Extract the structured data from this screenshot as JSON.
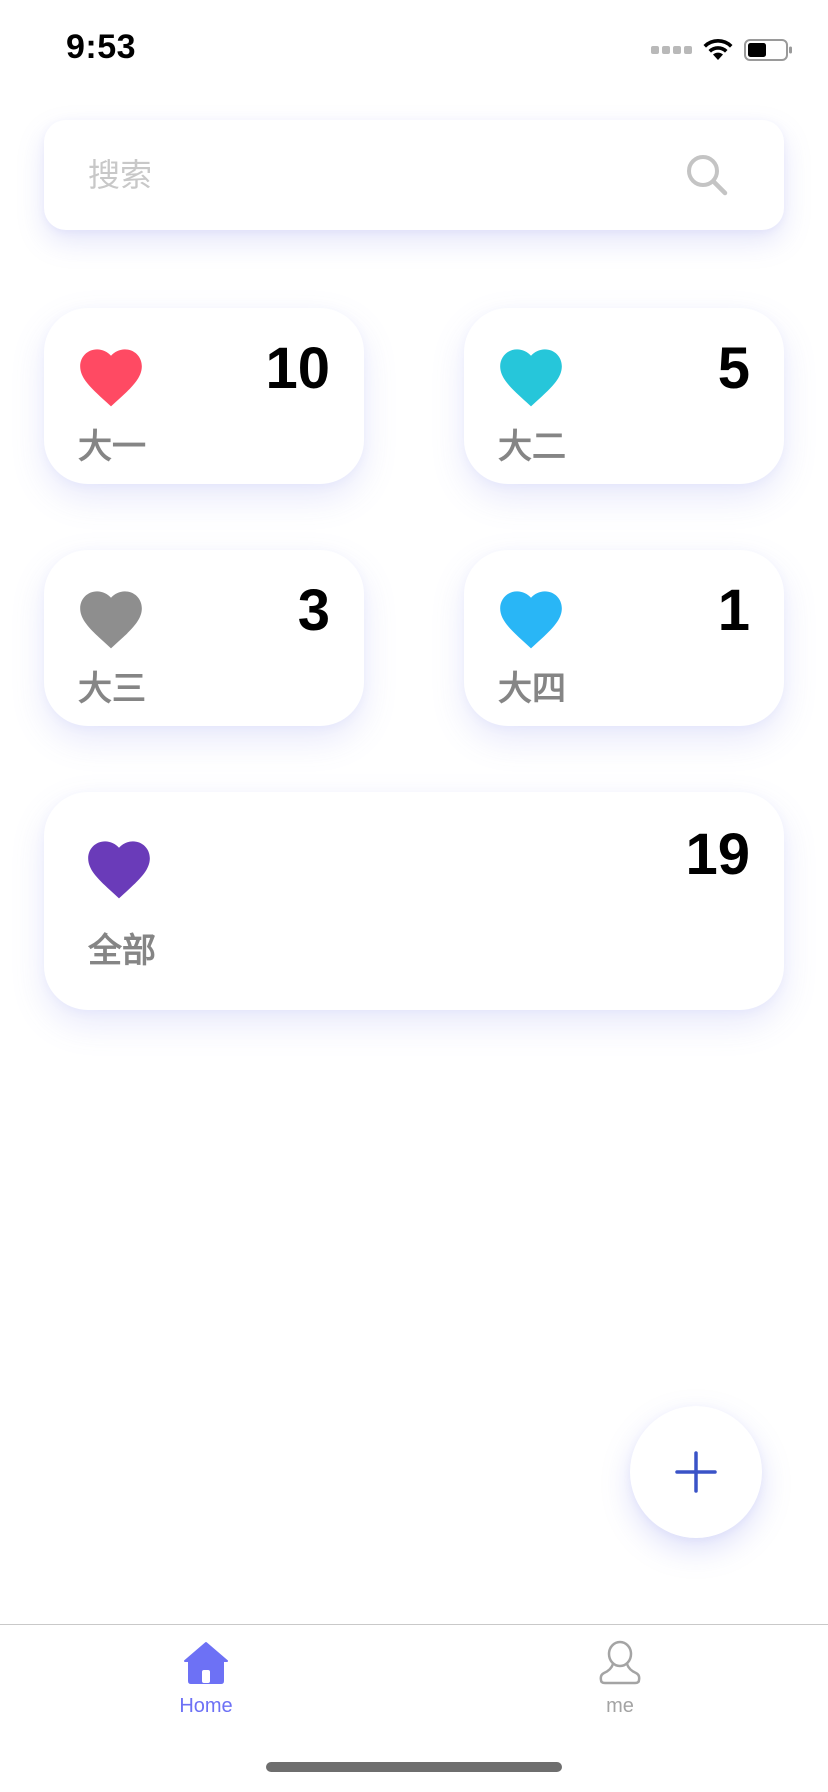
{
  "status_bar": {
    "time": "9:53"
  },
  "search": {
    "placeholder": "搜索",
    "value": ""
  },
  "categories": [
    {
      "label": "大一",
      "count": "10",
      "heart_color": "#ff4a63"
    },
    {
      "label": "大二",
      "count": "5",
      "heart_color": "#26c6da"
    },
    {
      "label": "大三",
      "count": "3",
      "heart_color": "#8e8e8e"
    },
    {
      "label": "大四",
      "count": "1",
      "heart_color": "#29b6f6"
    }
  ],
  "total": {
    "label": "全部",
    "count": "19",
    "heart_color": "#6a3bb9"
  },
  "fab": {
    "icon": "plus-icon",
    "color": "#3a53c7"
  },
  "tab_bar": {
    "tabs": [
      {
        "label": "Home",
        "icon": "home-icon",
        "active": true
      },
      {
        "label": "me",
        "icon": "user-icon",
        "active": false
      }
    ],
    "active_color": "#6d71f5",
    "inactive_color": "#a4a4a4"
  }
}
